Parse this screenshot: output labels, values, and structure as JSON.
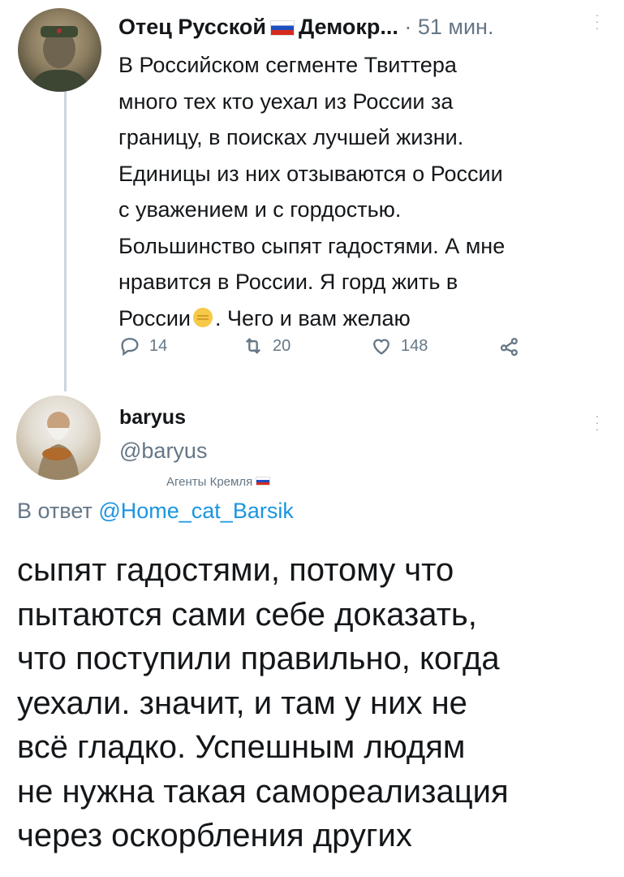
{
  "tweet1": {
    "author_name": "Отец Русской",
    "author_name_tail": "Демокр...",
    "separator": "·",
    "time": "51 мин.",
    "text_lines": [
      "В Российском сегменте Твиттера",
      "много тех кто уехал из России за",
      "границу, в поисках лучшей жизни.",
      "Единицы из них отзываются о России",
      "с уважением и с гордостью.",
      "Большинство сыпят гадостями. А мне",
      "нравится в России. Я горд жить в",
      "России",
      ". Чего и вам желаю"
    ],
    "replies": "14",
    "retweets": "20",
    "likes": "148",
    "icons": [
      "reply-icon",
      "retweet-icon",
      "like-icon",
      "share-icon",
      "fist-emoji",
      "russia-flag-icon",
      "more-options-icon"
    ]
  },
  "tweet2": {
    "author_name": "baryus",
    "handle": "@baryus",
    "badge_text": "Агенты Кремля",
    "reply_prefix": "В ответ",
    "reply_to": "@Home_cat_Barsik",
    "text_lines": [
      "сыпят гадостями, потому что",
      "пытаются сами себе доказать,",
      "что поступили правильно, когда",
      "уехали. значит, и там у них не",
      "всё гладко. Успешным людям",
      "не нужна такая самореализация",
      "через оскорбления других"
    ]
  },
  "colors": {
    "link": "#1b95e0",
    "secondary": "#657786",
    "text": "#14171a",
    "thread_line": "#ccd6dd"
  }
}
